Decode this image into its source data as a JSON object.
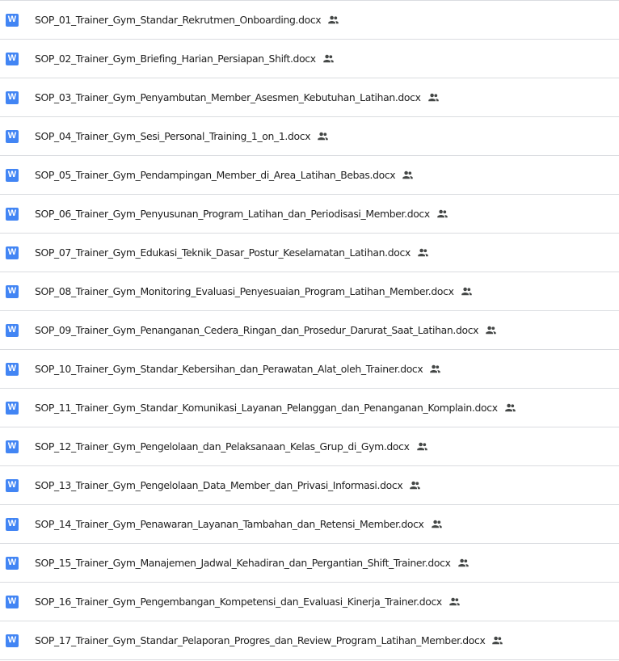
{
  "file_list": {
    "type_icon_letter": "W",
    "type_icon_name": "word-document-icon",
    "shared_icon_name": "people-shared-icon",
    "colors": {
      "word_blue": "#4285f4",
      "text": "#1f1f1f",
      "divider": "#dadce0",
      "shared_icon": "#444746"
    },
    "files": [
      {
        "name": "SOP_01_Trainer_Gym_Standar_Rekrutmen_Onboarding.docx",
        "shared": true
      },
      {
        "name": "SOP_02_Trainer_Gym_Briefing_Harian_Persiapan_Shift.docx",
        "shared": true
      },
      {
        "name": "SOP_03_Trainer_Gym_Penyambutan_Member_Asesmen_Kebutuhan_Latihan.docx",
        "shared": true
      },
      {
        "name": "SOP_04_Trainer_Gym_Sesi_Personal_Training_1_on_1.docx",
        "shared": true
      },
      {
        "name": "SOP_05_Trainer_Gym_Pendampingan_Member_di_Area_Latihan_Bebas.docx",
        "shared": true
      },
      {
        "name": "SOP_06_Trainer_Gym_Penyusunan_Program_Latihan_dan_Periodisasi_Member.docx",
        "shared": true
      },
      {
        "name": "SOP_07_Trainer_Gym_Edukasi_Teknik_Dasar_Postur_Keselamatan_Latihan.docx",
        "shared": true
      },
      {
        "name": "SOP_08_Trainer_Gym_Monitoring_Evaluasi_Penyesuaian_Program_Latihan_Member.docx",
        "shared": true
      },
      {
        "name": "SOP_09_Trainer_Gym_Penanganan_Cedera_Ringan_dan_Prosedur_Darurat_Saat_Latihan.docx",
        "shared": true
      },
      {
        "name": "SOP_10_Trainer_Gym_Standar_Kebersihan_dan_Perawatan_Alat_oleh_Trainer.docx",
        "shared": true
      },
      {
        "name": "SOP_11_Trainer_Gym_Standar_Komunikasi_Layanan_Pelanggan_dan_Penanganan_Komplain.docx",
        "shared": true
      },
      {
        "name": "SOP_12_Trainer_Gym_Pengelolaan_dan_Pelaksanaan_Kelas_Grup_di_Gym.docx",
        "shared": true
      },
      {
        "name": "SOP_13_Trainer_Gym_Pengelolaan_Data_Member_dan_Privasi_Informasi.docx",
        "shared": true
      },
      {
        "name": "SOP_14_Trainer_Gym_Penawaran_Layanan_Tambahan_dan_Retensi_Member.docx",
        "shared": true
      },
      {
        "name": "SOP_15_Trainer_Gym_Manajemen_Jadwal_Kehadiran_dan_Pergantian_Shift_Trainer.docx",
        "shared": true
      },
      {
        "name": "SOP_16_Trainer_Gym_Pengembangan_Kompetensi_dan_Evaluasi_Kinerja_Trainer.docx",
        "shared": true
      },
      {
        "name": "SOP_17_Trainer_Gym_Standar_Pelaporan_Progres_dan_Review_Program_Latihan_Member.docx",
        "shared": true
      }
    ]
  }
}
